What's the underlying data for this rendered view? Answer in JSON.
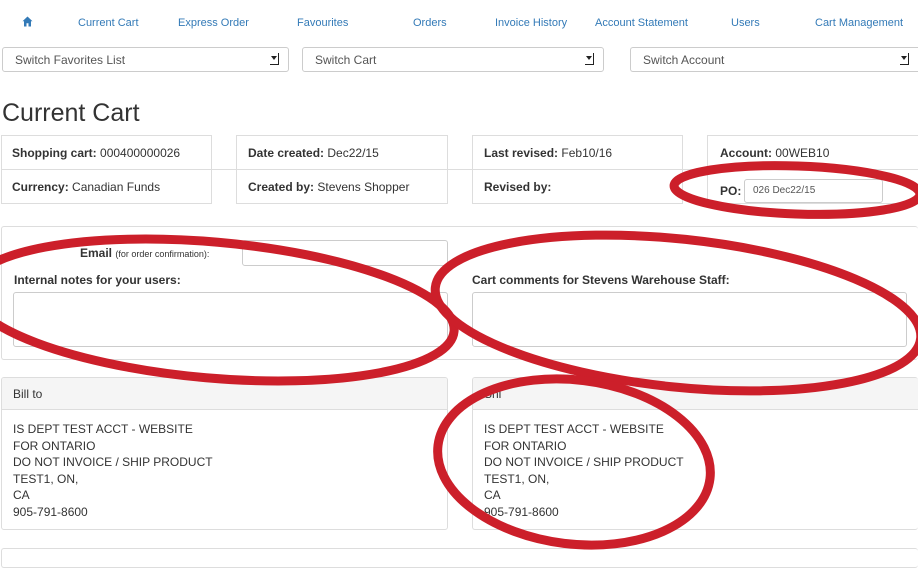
{
  "nav": {
    "home_label": "",
    "items": [
      "Current Cart",
      "Express Order",
      "Favourites",
      "Orders",
      "Invoice History",
      "Account Statement",
      "Users",
      "Cart Management"
    ]
  },
  "selects": {
    "favorites": "Switch Favorites List",
    "cart": "Switch Cart",
    "account": "Switch Account"
  },
  "page_title": "Current Cart",
  "cart_info": {
    "shopping_cart_label": "Shopping cart:",
    "shopping_cart": "000400000026",
    "date_created_label": "Date created:",
    "date_created": "Dec22/15",
    "last_revised_label": "Last revised:",
    "last_revised": "Feb10/16",
    "account_label": "Account:",
    "account": "00WEB10",
    "currency_label": "Currency:",
    "currency": "Canadian Funds",
    "created_by_label": "Created by:",
    "created_by": "Stevens Shopper",
    "revised_by_label": "Revised by:",
    "revised_by": "",
    "po_label": "PO:",
    "po_value": "026 Dec22/15"
  },
  "notes": {
    "email_label": "Email",
    "email_hint": "(for order confirmation):",
    "email_value": "",
    "internal_label": "Internal notes for your users:",
    "internal_value": "",
    "comments_label": "Cart comments for Stevens Warehouse Staff:",
    "comments_value": ""
  },
  "bill_to": {
    "heading": "Bill to",
    "lines": [
      "IS DEPT TEST ACCT - WEBSITE",
      "FOR ONTARIO",
      "DO NOT INVOICE / SHIP PRODUCT",
      "TEST1, ON,",
      "CA",
      "905-791-8600"
    ]
  },
  "ship_to": {
    "heading": "Shi",
    "lines": [
      "IS DEPT TEST ACCT - WEBSITE",
      "FOR ONTARIO",
      "DO NOT INVOICE / SHIP PRODUCT",
      "TEST1, ON,",
      "CA",
      "905-791-8600"
    ]
  },
  "colors": {
    "link": "#337ab7",
    "annotation_red": "#cc1f2a",
    "panel_header": "#f5f5f5",
    "border": "#dddddd"
  }
}
